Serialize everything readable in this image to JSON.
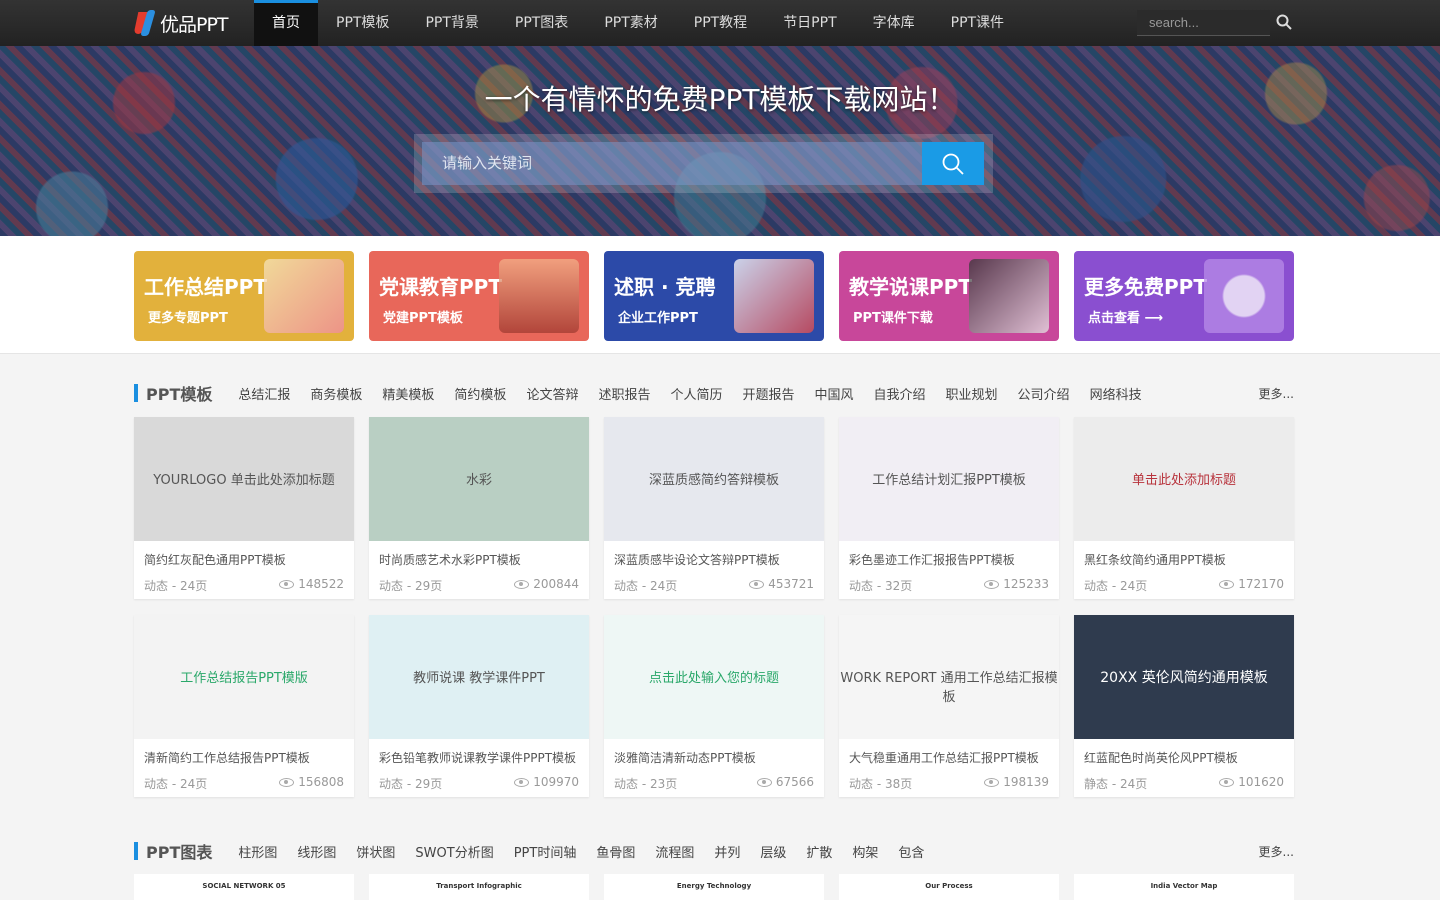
{
  "logo": {
    "text": "优品PPT"
  },
  "nav": [
    "首页",
    "PPT模板",
    "PPT背景",
    "PPT图表",
    "PPT素材",
    "PPT教程",
    "节日PPT",
    "字体库",
    "PPT课件"
  ],
  "top_search": {
    "placeholder": "search..."
  },
  "hero": {
    "title": "一个有情怀的免费PPT模板下载网站！",
    "placeholder": "请输入关键词"
  },
  "banners": [
    {
      "title": "工作总结PPT",
      "sub": "更多专题PPT",
      "color": "#e2b13c"
    },
    {
      "title": "党课教育PPT",
      "sub": "党建PPT模板",
      "color": "#e8675a"
    },
    {
      "title": "述职 · 竞聘",
      "sub": "企业工作PPT",
      "color": "#2c4aa8"
    },
    {
      "title": "教学说课PPT",
      "sub": "PPT课件下载",
      "color": "#c8479a"
    },
    {
      "title": "更多免费PPT",
      "sub": "点击查看 ⟶",
      "color": "#8a4fd0"
    }
  ],
  "section1": {
    "title": "PPT模板",
    "tags": [
      "总结汇报",
      "商务模板",
      "精美模板",
      "简约模板",
      "论文答辩",
      "述职报告",
      "个人简历",
      "开题报告",
      "中国风",
      "自我介绍",
      "职业规划",
      "公司介绍",
      "网络科技"
    ],
    "more": "更多...",
    "cards": [
      {
        "title": "简约红灰配色通用PPT模板",
        "meta": "动态 - 24页",
        "views": "148522",
        "thumb": "YOURLOGO 单击此处添加标题",
        "bg": "#d9d9d9"
      },
      {
        "title": "时尚质感艺术水彩PPT模板",
        "meta": "动态 - 29页",
        "views": "200844",
        "thumb": "水彩",
        "bg": "#b9cfc3"
      },
      {
        "title": "深蓝质感毕设论文答辩PPT模板",
        "meta": "动态 - 24页",
        "views": "453721",
        "thumb": "深蓝质感简约答辩模板",
        "bg": "#e6e8ee"
      },
      {
        "title": "彩色墨迹工作汇报报告PPT模板",
        "meta": "动态 - 32页",
        "views": "125233",
        "thumb": "工作总结计划汇报PPT模板",
        "bg": "#f1eef4"
      },
      {
        "title": "黑红条纹简约通用PPT模板",
        "meta": "动态 - 24页",
        "views": "172170",
        "thumb": "单击此处添加标题",
        "bg": "#ececec"
      },
      {
        "title": "清新简约工作总结报告PPT模板",
        "meta": "动态 - 24页",
        "views": "156808",
        "thumb": "工作总结报告PPT模版",
        "bg": "#f3f3f3"
      },
      {
        "title": "彩色铅笔教师说课教学课件PPPT模板",
        "meta": "动态 - 29页",
        "views": "109970",
        "thumb": "教师说课 教学课件PPT",
        "bg": "#dff0f3"
      },
      {
        "title": "淡雅简洁清新动态PPT模板",
        "meta": "动态 - 23页",
        "views": "67566",
        "thumb": "点击此处输入您的标题",
        "bg": "#eef7f5"
      },
      {
        "title": "大气稳重通用工作总结汇报PPT模板",
        "meta": "动态 - 38页",
        "views": "198139",
        "thumb": "WORK REPORT 通用工作总结汇报模板",
        "bg": "#f5f5f5"
      },
      {
        "title": "红蓝配色时尚英伦风PPT模板",
        "meta": "静态 - 24页",
        "views": "101620",
        "thumb": "20XX 英伦风简约通用模板",
        "bg": "#2f3b4e"
      }
    ]
  },
  "section2": {
    "title": "PPT图表",
    "tags": [
      "柱形图",
      "线形图",
      "饼状图",
      "SWOT分析图",
      "PPT时间轴",
      "鱼骨图",
      "流程图",
      "并列",
      "层级",
      "扩散",
      "构架",
      "包含"
    ],
    "more": "更多...",
    "peeks": [
      "SOCIAL NETWORK 05",
      "Transport Infographic",
      "Energy Technology",
      "Our Process",
      "India Vector Map"
    ]
  }
}
